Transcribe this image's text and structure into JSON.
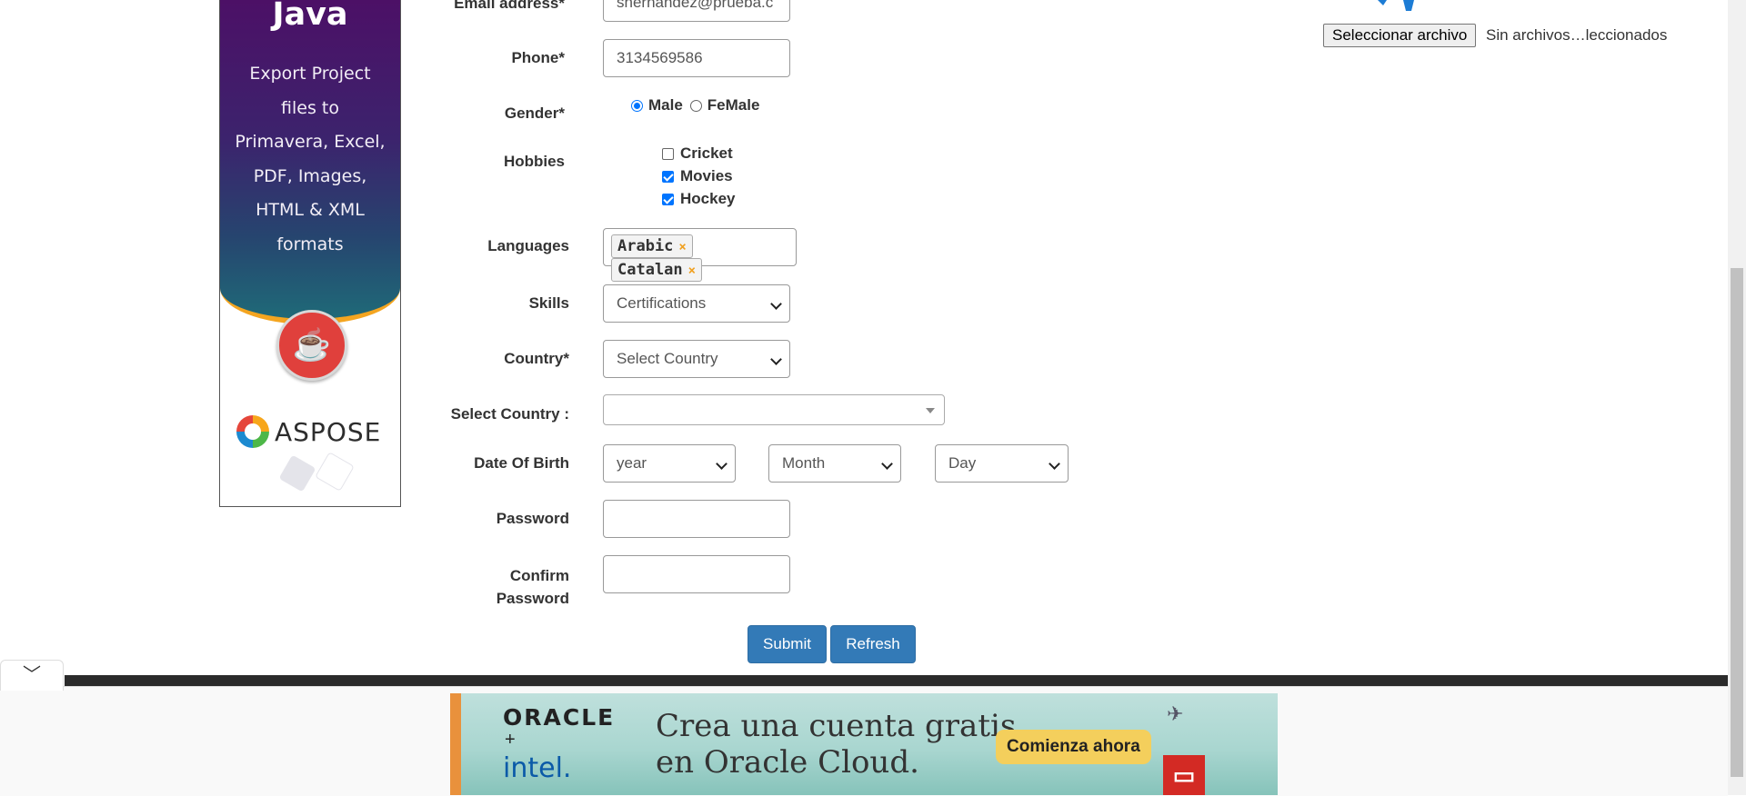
{
  "left_ad": {
    "title": "Java",
    "text_lines": [
      "Export Project",
      "files to",
      "Primavera, Excel,",
      "PDF, Images,",
      "HTML & XML",
      "formats"
    ],
    "brand": "ASPOSE"
  },
  "form": {
    "email": {
      "label": "Email address*",
      "value": "shernandez@prueba.c"
    },
    "phone": {
      "label": "Phone*",
      "value": "3134569586"
    },
    "gender": {
      "label": "Gender*",
      "options": [
        "Male",
        "FeMale"
      ],
      "selected": "Male"
    },
    "hobbies": {
      "label": "Hobbies",
      "options": [
        {
          "label": "Cricket",
          "checked": false
        },
        {
          "label": "Movies",
          "checked": true
        },
        {
          "label": "Hockey",
          "checked": true
        }
      ]
    },
    "languages": {
      "label": "Languages",
      "selected": [
        "Arabic",
        "Catalan"
      ],
      "remove_symbol": "×"
    },
    "skills": {
      "label": "Skills",
      "value": "Certifications"
    },
    "country": {
      "label": "Country*",
      "value": "Select Country"
    },
    "select_country": {
      "label": "Select Country :",
      "value": ""
    },
    "dob": {
      "label": "Date Of Birth",
      "year": "year",
      "month": "Month",
      "day": "Day"
    },
    "password": {
      "label": "Password",
      "value": ""
    },
    "confirm_password": {
      "label_line1": "Confirm",
      "label_line2": "Password",
      "value": ""
    },
    "submit_label": "Submit",
    "refresh_label": "Refresh"
  },
  "file_upload": {
    "button_label": "Seleccionar archivo",
    "status": "Sin archivos…leccionados"
  },
  "bottom_ad": {
    "brand1": "ORACLE",
    "plus": "+",
    "brand2": "intel.",
    "headline_line1": "Crea una cuenta gratis",
    "headline_line2": "en Oracle Cloud.",
    "cta": "Comienza ahora"
  },
  "colors": {
    "primary_button": "#337ab7",
    "checkbox_accent": "#0075ff",
    "tag_remove": "#f0a020",
    "ad_purple": "#4d0f66",
    "ad_orange": "#f4a520"
  }
}
